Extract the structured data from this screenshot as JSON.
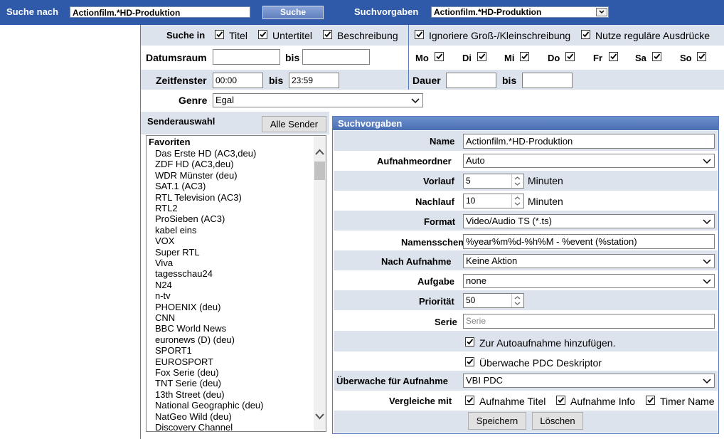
{
  "topbar": {
    "search_label": "Suche nach",
    "search_value": "Actionfilm.*HD-Produktion",
    "search_button": "Suche",
    "presets_label": "Suchvorgaben",
    "presets_value": "Actionfilm.*HD-Produktion"
  },
  "filters": {
    "search_in_label": "Suche in",
    "title": "Titel",
    "subtitle": "Untertitel",
    "description": "Beschreibung",
    "ignore_case": "Ignoriere Groß-/Kleinschreibung",
    "regex": "Nutze reguläre Ausdrücke",
    "date_range_label": "Datumsraum",
    "to": "bis",
    "days": [
      "Mo",
      "Di",
      "Mi",
      "Do",
      "Fr",
      "Sa",
      "So"
    ],
    "time_window_label": "Zeitfenster",
    "time_from": "00:00",
    "time_to": "23:59",
    "duration_label": "Dauer",
    "genre_label": "Genre",
    "genre_value": "Egal"
  },
  "channels": {
    "title": "Senderauswahl",
    "all_button": "Alle Sender",
    "group": "Favoriten",
    "items": [
      "Das Erste HD (AC3,deu)",
      "ZDF HD (AC3,deu)",
      "WDR Münster (deu)",
      "SAT.1 (AC3)",
      "RTL Television (AC3)",
      "RTL2",
      "ProSieben (AC3)",
      "kabel eins",
      "VOX",
      "Super RTL",
      "Viva",
      "tagesschau24",
      "N24",
      "n-tv",
      "PHOENIX (deu)",
      "CNN",
      "BBC World News",
      "euronews (D) (deu)",
      "SPORT1",
      "EUROSPORT",
      "Fox Serie (deu)",
      "TNT Serie (deu)",
      "13th Street (deu)",
      "National Geographic (deu)",
      "NatGeo Wild (deu)",
      "Discovery Channel"
    ]
  },
  "preset": {
    "title": "Suchvorgaben",
    "name_label": "Name",
    "name_value": "Actionfilm.*HD-Produktion",
    "folder_label": "Aufnahmeordner",
    "folder_value": "Auto",
    "pre_label": "Vorlauf",
    "pre_value": "5",
    "minutes": "Minuten",
    "post_label": "Nachlauf",
    "post_value": "10",
    "format_label": "Format",
    "format_value": "Video/Audio TS (*.ts)",
    "naming_label": "Namensschema",
    "naming_value": "%year%m%d-%h%M - %event (%station)",
    "after_label": "Nach Aufnahme",
    "after_value": "Keine Aktion",
    "task_label": "Aufgabe",
    "task_value": "none",
    "priority_label": "Priorität",
    "priority_value": "50",
    "series_label": "Serie",
    "series_placeholder": "Serie",
    "auto_add": "Zur Autoaufnahme hinzufügen.",
    "pdc": "Überwache PDC Deskriptor",
    "watch_label": "Überwache für Aufnahme",
    "watch_value": "VBI PDC",
    "compare_label": "Vergleiche mit",
    "cmp_title": "Aufnahme Titel",
    "cmp_info": "Aufnahme Info",
    "cmp_timer": "Timer Name",
    "save": "Speichern",
    "delete": "Löschen"
  }
}
